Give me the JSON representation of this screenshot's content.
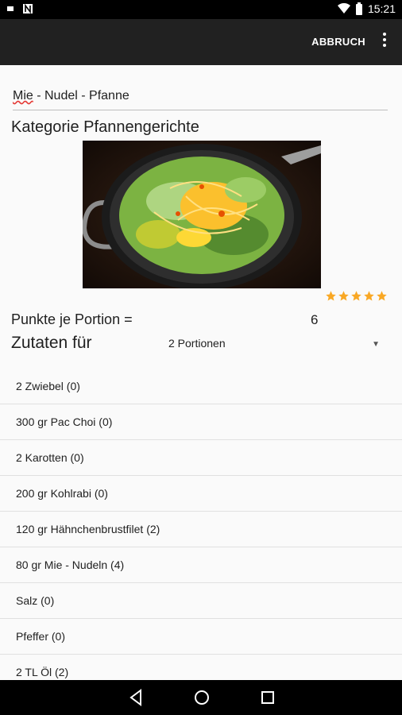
{
  "status_bar": {
    "time": "15:21"
  },
  "app_bar": {
    "cancel_label": "ABBRUCH"
  },
  "recipe": {
    "title_word1": "Mie",
    "title_rest": " - Nudel  - Pfanne",
    "category_text": "Kategorie  Pfannengerichte",
    "rating_stars": 5,
    "points_label": "Punkte je Portion =",
    "points_value": "6",
    "ingredients_for_label": "Zutaten für",
    "portions_selected": "2 Portionen"
  },
  "ingredients": [
    "2 Zwiebel  (0)",
    "300 gr Pac Choi  (0)",
    "2 Karotten  (0)",
    "200 gr Kohlrabi  (0)",
    "120 gr Hähnchenbrustfilet  (2)",
    "80 gr Mie - Nudeln  (4)",
    "Salz  (0)",
    "Pfeffer  (0)",
    "2 TL Öl (2)"
  ],
  "colors": {
    "star": "#f9a825",
    "app_bar": "#212121",
    "background": "#fafafa"
  },
  "icons": [
    "sim-icon",
    "n-icon",
    "wifi-icon",
    "battery-icon",
    "overflow-menu-icon",
    "back-icon",
    "home-icon",
    "recents-icon"
  ]
}
